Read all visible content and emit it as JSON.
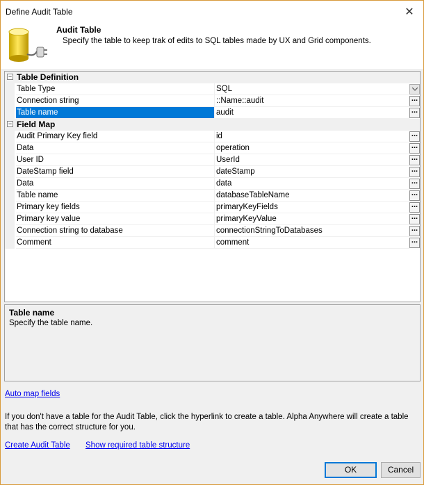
{
  "window": {
    "title": "Define Audit Table",
    "close_glyph": "✕"
  },
  "header": {
    "title": "Audit Table",
    "description": "Specify the table to keep trak of edits to SQL tables made by UX and Grid components.",
    "icon": "database-plug-icon"
  },
  "grid": {
    "categories": [
      {
        "label": "Table Definition",
        "toggle": "−"
      },
      {
        "label": "Field Map",
        "toggle": "−"
      }
    ],
    "table_definition": [
      {
        "label": "Table Type",
        "value": "SQL",
        "control": "dropdown"
      },
      {
        "label": "Connection string",
        "value": "::Name::audit",
        "control": "ellipsis"
      },
      {
        "label": "Table name",
        "value": "audit",
        "control": "ellipsis",
        "selected": true
      }
    ],
    "field_map": [
      {
        "label": "Audit Primary Key field",
        "value": "id"
      },
      {
        "label": "Data",
        "value": "operation"
      },
      {
        "label": "User ID",
        "value": "UserId"
      },
      {
        "label": "DateStamp field",
        "value": "dateStamp"
      },
      {
        "label": "Data",
        "value": "data"
      },
      {
        "label": "Table name",
        "value": "databaseTableName"
      },
      {
        "label": "Primary key fields",
        "value": "primaryKeyFields"
      },
      {
        "label": "Primary key value",
        "value": "primaryKeyValue"
      },
      {
        "label": "Connection string to database",
        "value": "connectionStringToDatabases"
      },
      {
        "label": "Comment",
        "value": "comment"
      }
    ],
    "ellipsis_label": "..."
  },
  "help": {
    "title": "Table name",
    "text": "Specify the table name."
  },
  "links": {
    "auto_map": "Auto map fields",
    "create_table": "Create Audit Table",
    "show_structure": "Show required table structure"
  },
  "info_text": "If you don't have a table for the Audit Table, click the hyperlink to create a table. Alpha Anywhere will create a table that has the correct structure for you.",
  "buttons": {
    "ok": "OK",
    "cancel": "Cancel"
  },
  "colors": {
    "selection": "#0078d7",
    "link": "#0000ee",
    "window_border": "#d89a3a"
  }
}
